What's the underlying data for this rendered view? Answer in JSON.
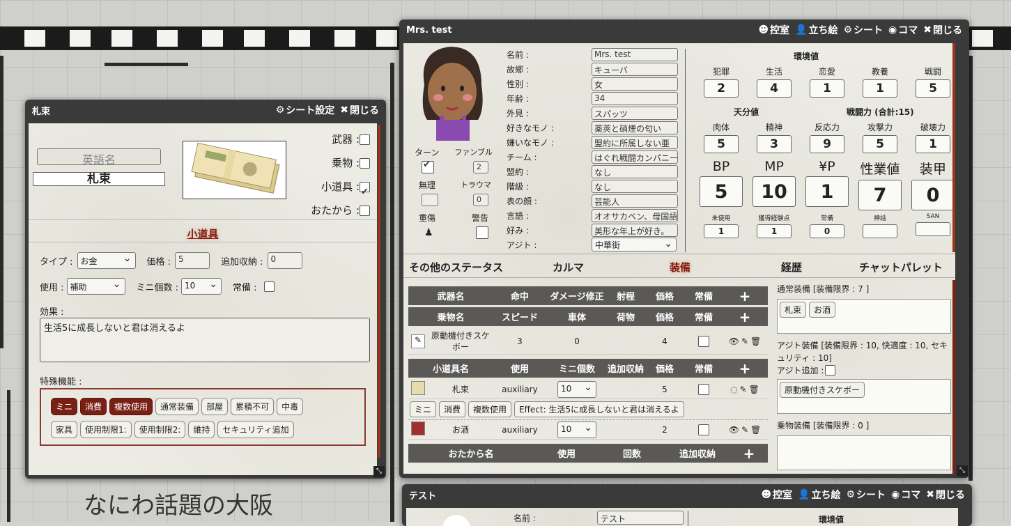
{
  "left_window": {
    "title": "札束",
    "sheet_settings": "シート設定",
    "close": "閉じる",
    "english_name_placeholder": "英語名",
    "item_name": "札束",
    "flags": [
      {
        "label": "武器 :",
        "checked": false
      },
      {
        "label": "乗物 :",
        "checked": false
      },
      {
        "label": "小道具 :",
        "checked": true
      },
      {
        "label": "おたから :",
        "checked": false
      }
    ],
    "section_title": "小道具",
    "type_label": "タイプ :",
    "type_value": "お金",
    "price_label": "価格 :",
    "price_value": "5",
    "extra_storage_label": "追加収納 :",
    "extra_storage_value": "0",
    "use_label": "使用 :",
    "use_value": "補助",
    "mini_count_label": "ミニ個数 :",
    "mini_count_value": "10",
    "always_label": "常備 :",
    "effect_label": "効果 :",
    "effect_text": "生活5に成長しないと君は消えるよ",
    "special_label": "特殊機能 :",
    "special_chips_row1": [
      {
        "t": "ミニ",
        "on": true
      },
      {
        "t": "消費",
        "on": true
      },
      {
        "t": "複数使用",
        "on": true
      },
      {
        "t": "通常装備",
        "on": false
      },
      {
        "t": "部屋",
        "on": false
      },
      {
        "t": "累積不可",
        "on": false
      },
      {
        "t": "中毒",
        "on": false
      }
    ],
    "special_chips_row2": [
      {
        "t": "家具",
        "on": false
      },
      {
        "t": "使用制限1:",
        "on": false
      },
      {
        "t": "使用制限2:",
        "on": false
      },
      {
        "t": "維持",
        "on": false
      },
      {
        "t": "セキュリティ追加",
        "on": false
      }
    ]
  },
  "main_window": {
    "title": "Mrs. test",
    "toolbar": {
      "hikae": "控室",
      "tachie": "立ち絵",
      "sheet": "シート",
      "koma": "コマ",
      "close": "閉じる"
    },
    "turn_label": "ターン",
    "fumble_label": "ファンブル",
    "fumble_value": "2",
    "muno_label": "無理",
    "trauma_label": "トラウマ",
    "trauma_value": "0",
    "jusho_label": "重傷",
    "keikoku_label": "警告",
    "profile": [
      {
        "k": "名前 :",
        "v": "Mrs. test"
      },
      {
        "k": "故郷 :",
        "v": "キューバ"
      },
      {
        "k": "性別 :",
        "v": "女"
      },
      {
        "k": "年齢 :",
        "v": "34"
      },
      {
        "k": "外見 :",
        "v": "スパッツ"
      },
      {
        "k": "好きなモノ :",
        "v": "薬莢と硝煙の匂い"
      },
      {
        "k": "嫌いなモノ :",
        "v": "盟約に所属しない亜"
      },
      {
        "k": "チーム :",
        "v": "はぐれ戦闘カンパニー"
      },
      {
        "k": "盟約 :",
        "v": "なし"
      },
      {
        "k": "階級 :",
        "v": "なし"
      },
      {
        "k": "表の顔 :",
        "v": "芸能人"
      },
      {
        "k": "言語 :",
        "v": "オオサカベン、母国語"
      },
      {
        "k": "好み :",
        "v": "美形な年上が好き。"
      }
    ],
    "ajito_label": "アジト :",
    "ajito_value": "中華街",
    "env_title": "環境値",
    "env": [
      {
        "k": "犯罪",
        "v": "2"
      },
      {
        "k": "生活",
        "v": "4"
      },
      {
        "k": "恋愛",
        "v": "1"
      },
      {
        "k": "教養",
        "v": "1"
      },
      {
        "k": "戦闘",
        "v": "5"
      }
    ],
    "tenbun_title": "天分値",
    "sentou_title": "戦闘力 (合計:15)",
    "tenbun": [
      {
        "k": "肉体",
        "v": "5"
      },
      {
        "k": "精神",
        "v": "3"
      },
      {
        "k": "反応力",
        "v": "9"
      },
      {
        "k": "攻撃力",
        "v": "5"
      },
      {
        "k": "破壊力",
        "v": "1"
      }
    ],
    "big": [
      {
        "k": "BP",
        "v": "5"
      },
      {
        "k": "MP",
        "v": "10"
      },
      {
        "k": "¥P",
        "v": "1"
      },
      {
        "k": "性業値",
        "v": "7"
      },
      {
        "k": "装甲",
        "v": "0"
      }
    ],
    "small": [
      {
        "k": "未使用",
        "v": "1"
      },
      {
        "k": "獲得経験点",
        "v": "1"
      },
      {
        "k": "常備",
        "v": "0"
      },
      {
        "k": "神話",
        "v": ""
      },
      {
        "k": "SAN",
        "v": ""
      }
    ],
    "tabs": [
      "その他のステータス",
      "カルマ",
      "装備",
      "経歴",
      "チャットパレット"
    ],
    "weapon_header": [
      "武器名",
      "命中",
      "ダメージ修正",
      "射程",
      "価格",
      "常備",
      "+"
    ],
    "vehicle_header": [
      "乗物名",
      "スピード",
      "車体",
      "荷物",
      "価格",
      "常備",
      "+"
    ],
    "vehicle_row": {
      "name": "原動機付きスケボー",
      "speed": "3",
      "body": "0",
      "cargo": "",
      "price": "4"
    },
    "prop_header": [
      "小道具名",
      "使用",
      "ミニ個数",
      "追加収納",
      "価格",
      "常備",
      "+"
    ],
    "prop_rows": [
      {
        "name": "札束",
        "use": "auxiliary",
        "mini": "10",
        "price": "5"
      },
      {
        "name": "お酒",
        "use": "auxiliary",
        "mini": "10",
        "price": "2"
      }
    ],
    "prop_tags": [
      "ミニ",
      "消費",
      "複数使用",
      "Effect: 生活5に成長しないと君は消えるよ"
    ],
    "treasure_header": [
      "おたから名",
      "使用",
      "回数",
      "追加収納",
      "+"
    ],
    "normal_equip_label": "通常装備 [装備限界 : 7 ]",
    "normal_equip_items": [
      "札束",
      "お酒"
    ],
    "ajito_equip_label": "アジト装備 [装備限界 : 10, 快適度 : 10, セキュリティ : 10]",
    "ajito_add_label": "アジト追加 :",
    "ajito_equip_items": [
      "原動機付きスケボー"
    ],
    "vehicle_equip_label": "乗物装備 [装備限界 : 0 ]"
  },
  "bottom_window": {
    "title": "テスト",
    "toolbar": {
      "hikae": "控室",
      "tachie": "立ち絵",
      "sheet": "シート",
      "koma": "コマ",
      "close": "閉じる"
    },
    "name_label": "名前 :",
    "name_value": "テスト",
    "env_title": "環境値"
  },
  "background_text": "なにわ話題の大阪"
}
